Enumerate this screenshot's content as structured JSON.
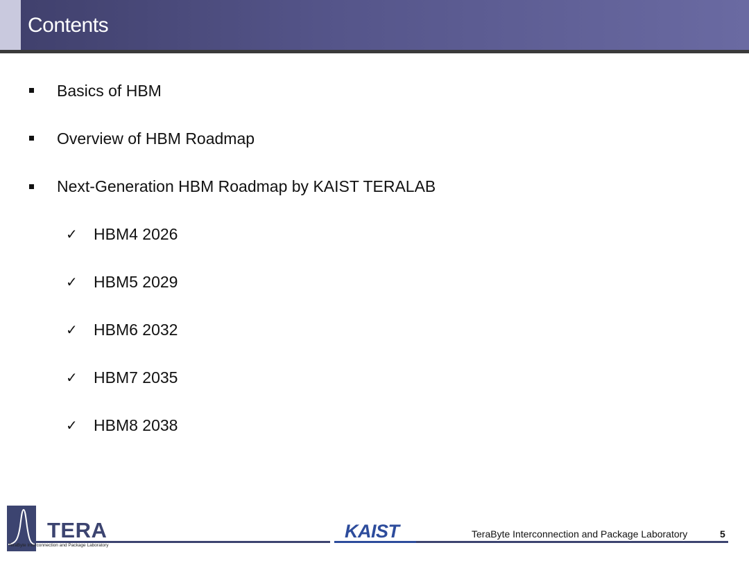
{
  "header": {
    "title": "Contents"
  },
  "bullets": [
    {
      "label": "Basics of HBM"
    },
    {
      "label": "Overview of HBM Roadmap"
    },
    {
      "label": "Next-Generation HBM Roadmap by KAIST TERALAB"
    }
  ],
  "sub_items": [
    {
      "label": "HBM4 2026"
    },
    {
      "label": "HBM5 2029"
    },
    {
      "label": "HBM6 2032"
    },
    {
      "label": "HBM7 2035"
    },
    {
      "label": "HBM8 2038"
    }
  ],
  "footer": {
    "logo_text": "TERA",
    "logo_subtitle": "TeraByte Interconnection and Package Laboratory",
    "kaist_logo": "KAIST",
    "lab_name": "TeraByte Interconnection and Package Laboratory",
    "page_number": "5"
  },
  "colors": {
    "header_bar": "#55558a",
    "accent": "#3c4470",
    "kaist_blue": "#2d4c9c"
  }
}
